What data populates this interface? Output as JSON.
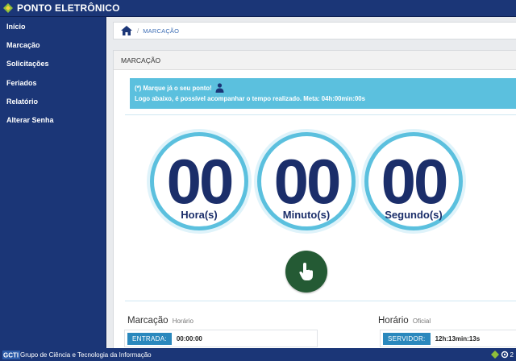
{
  "app": {
    "title": "PONTO ELETRÔNICO"
  },
  "sidebar": {
    "items": [
      {
        "label": "Início"
      },
      {
        "label": "Marcação"
      },
      {
        "label": "Solicitações"
      },
      {
        "label": "Feriados"
      },
      {
        "label": "Relatório"
      },
      {
        "label": "Alterar Senha"
      }
    ]
  },
  "breadcrumb": {
    "current": "MARCAÇÃO",
    "separator": "/"
  },
  "panel": {
    "title": "MARCAÇÃO"
  },
  "alert": {
    "line1": "(*) Marque já o seu ponto!",
    "line2": "Logo abaixo, é possível acompanhar o tempo realizado. Meta: 04h:00min:00s"
  },
  "timer": {
    "hours": "00",
    "hours_label": "Hora(s)",
    "minutes": "00",
    "minutes_label": "Minuto(s)",
    "seconds": "00",
    "seconds_label": "Segundo(s)"
  },
  "marcacao": {
    "title": "Marcação",
    "subtitle": "Horário",
    "entrada_label": "ENTRADA:",
    "entrada_value": "00:00:00"
  },
  "horario": {
    "title": "Horário",
    "subtitle": "Oficial",
    "servidor_label": "SERVIDOR:",
    "servidor_value": "12h:13min:13s"
  },
  "footer": {
    "text": "Grupo de Ciência e Tecnologia da Informação",
    "right_text": "2"
  },
  "colors": {
    "navy": "#1b3677",
    "alert": "#5bc0de",
    "timer_text": "#1b2e6a",
    "punch_button": "#245a34",
    "label_badge": "#2a88bd"
  },
  "icons": [
    "diamond-logo-icon",
    "home-icon",
    "user-icon",
    "hand-pointer-icon",
    "gcti-logo",
    "diamond-icon",
    "gear-icon"
  ]
}
